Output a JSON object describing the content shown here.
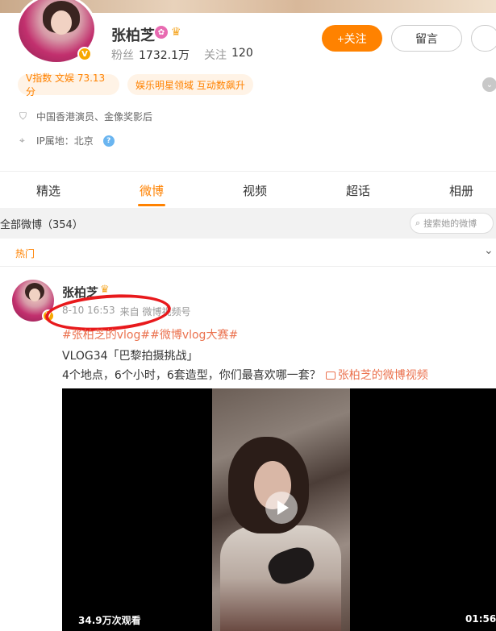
{
  "profile": {
    "name": "张柏芝",
    "followers_label": "粉丝",
    "followers_value": "1732.1万",
    "following_label": "关注",
    "following_value": "120",
    "verified_badge": "V",
    "follow_button": "+关注",
    "message_button": "留言"
  },
  "tags": {
    "v_index": "V指数 文娱 73.13分",
    "domain": "娱乐明星领域 互动数飙升"
  },
  "info": {
    "description": "中国香港演员、金像奖影后",
    "ip_location": "IP属地：北京"
  },
  "tabs": [
    "精选",
    "微博",
    "视频",
    "超话",
    "相册"
  ],
  "active_tab": "微博",
  "filter": {
    "label": "全部微博（354）",
    "search_placeholder": "搜索她的微博"
  },
  "hot_label": "热门",
  "post": {
    "author": "张柏芝",
    "time": "8-10 16:53",
    "source": "来自 微博视频号",
    "hashtags": "#张柏芝的vlog##微博vlog大赛#",
    "line1": "VLOG34「巴黎拍摄挑战」",
    "line2": "4个地点，6个小时，6套造型，你们最喜欢哪一套？",
    "video_link": "张柏芝的微博视频",
    "video": {
      "views": "34.9万次观看",
      "duration": "01:56"
    }
  },
  "colors": {
    "accent": "#ff8200",
    "link": "#eb7350",
    "annotation": "#e8191c"
  }
}
